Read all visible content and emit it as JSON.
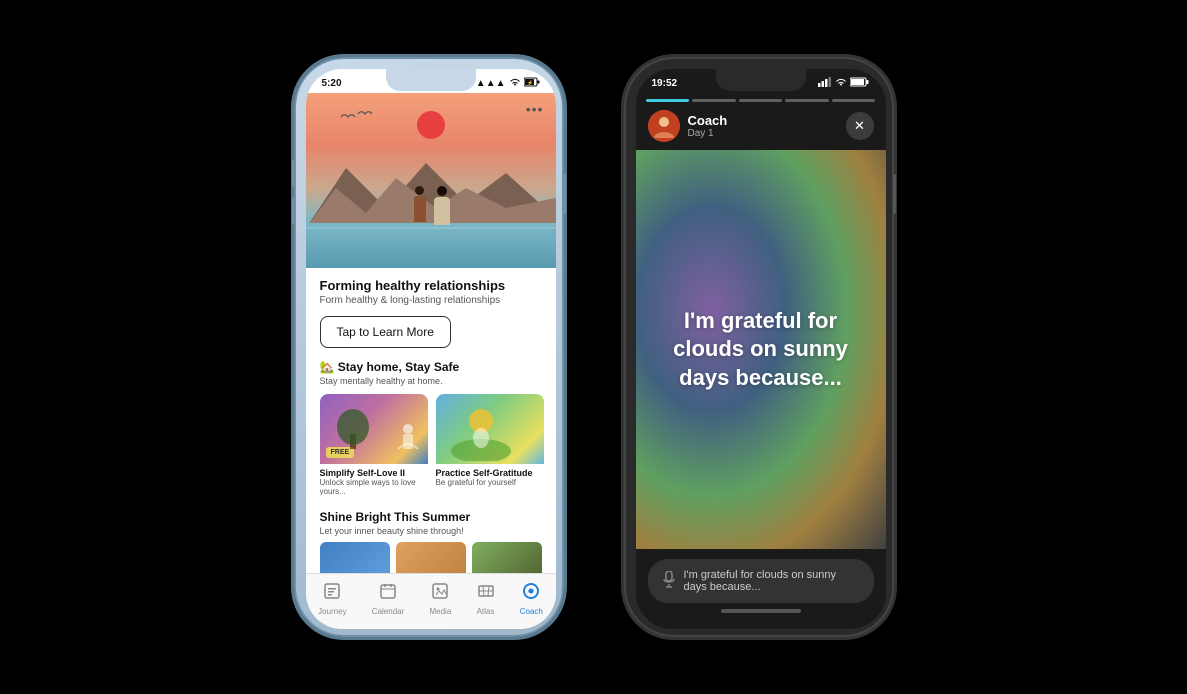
{
  "phone1": {
    "status": {
      "time": "5:20",
      "signal": "▲▲▲",
      "wifi": "WiFi",
      "battery": "⚡"
    },
    "hero": {
      "more_dots": "•••"
    },
    "relationships": {
      "title": "Forming healthy relationships",
      "subtitle": "Form healthy & long-lasting relationships"
    },
    "tap_button": "Tap to Learn More",
    "stay_home": {
      "emoji": "🏡",
      "title": "Stay home, Stay Safe",
      "subtitle": "Stay mentally healthy at home."
    },
    "cards": [
      {
        "title": "Simplify Self-Love II",
        "desc": "Unlock simple ways to love yours...",
        "badge": "FREE"
      },
      {
        "title": "Practice Self-Gratitude",
        "desc": "Be grateful for yourself"
      }
    ],
    "shine": {
      "title": "Shine Bright This Summer",
      "subtitle": "Let your inner beauty shine through!"
    },
    "tabs": [
      {
        "label": "Journey",
        "icon": "⬛",
        "active": false
      },
      {
        "label": "Calendar",
        "icon": "📅",
        "active": false
      },
      {
        "label": "Media",
        "icon": "🖼",
        "active": false
      },
      {
        "label": "Atlas",
        "icon": "🗺",
        "active": false
      },
      {
        "label": "Coach",
        "icon": "💙",
        "active": true
      }
    ]
  },
  "phone2": {
    "status": {
      "time": "19:52",
      "signal": "▲▲▲",
      "wifi": "WiFi",
      "battery": "🔋"
    },
    "progress_bars": [
      {
        "active": true
      },
      {
        "active": false
      },
      {
        "active": false
      },
      {
        "active": false
      },
      {
        "active": false
      }
    ],
    "coach": {
      "name": "Coach",
      "day": "Day 1"
    },
    "close": "✕",
    "main_text": "I'm grateful for clouds on sunny days because...",
    "input_placeholder": "I'm grateful for clouds on sunny days because...",
    "mic_icon": "🎙"
  }
}
